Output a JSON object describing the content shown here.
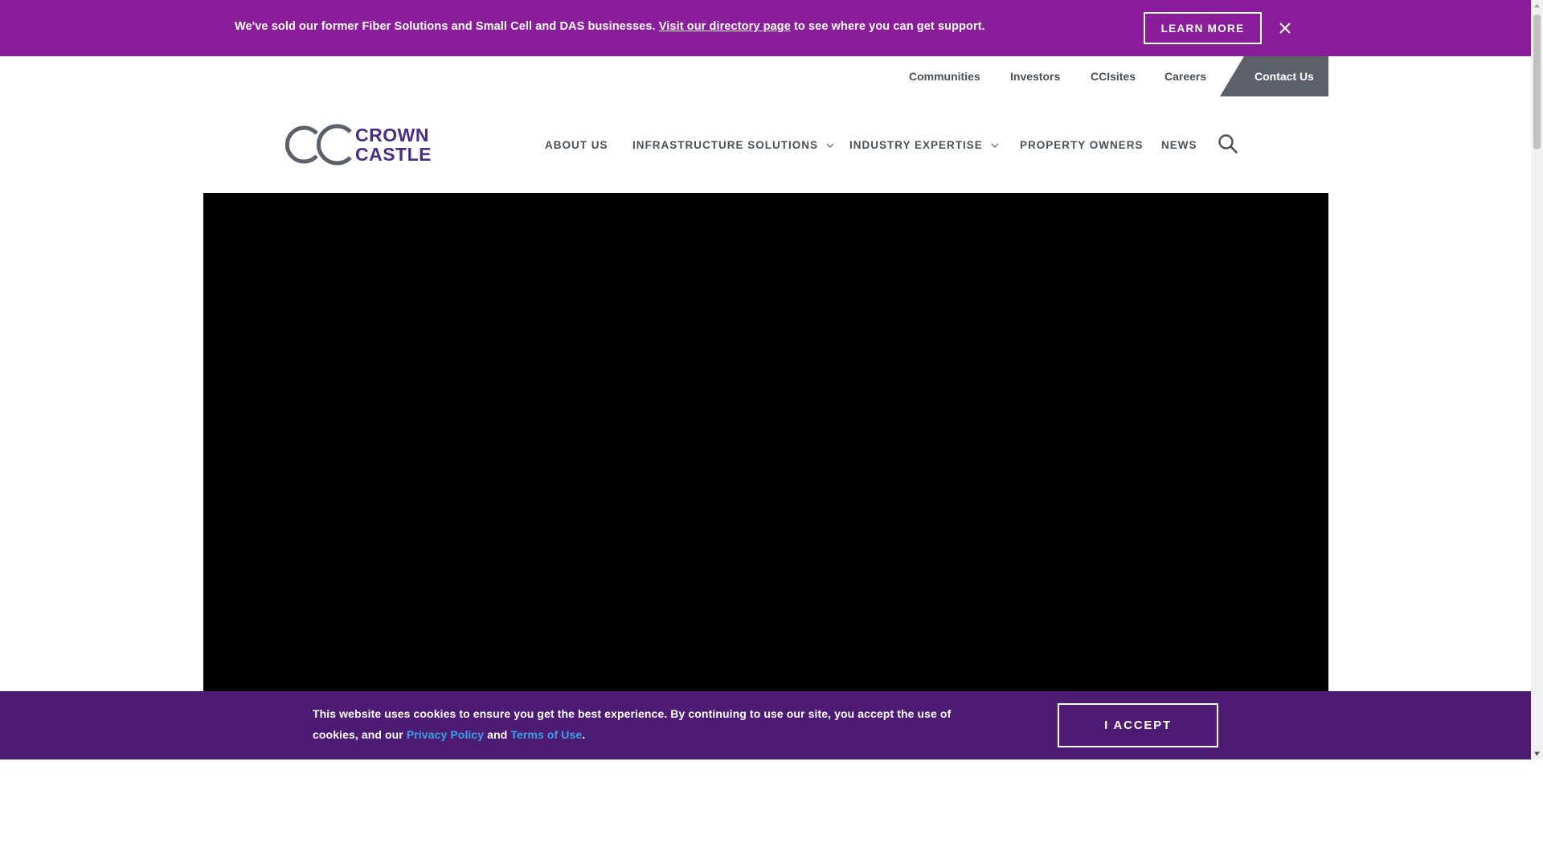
{
  "banner": {
    "text_before": "We've sold our former Fiber Solutions and Small Cell and DAS businesses. ",
    "link_text": "Visit our directory page",
    "text_after": " to see where you can get support.",
    "learn_more": "LEARN MORE"
  },
  "utility_nav": {
    "items": [
      "Communities",
      "Investors",
      "CCIsites",
      "Careers"
    ],
    "contact": "Contact Us"
  },
  "logo": {
    "line1": "CROWN",
    "line2": "CASTLE"
  },
  "main_nav": {
    "items": [
      {
        "label": "ABOUT US"
      },
      {
        "label": "INFRASTRUCTURE SOLUTIONS"
      },
      {
        "label": "INDUSTRY EXPERTISE"
      },
      {
        "label": "PROPERTY OWNERS"
      },
      {
        "label": "NEWS"
      }
    ]
  },
  "cookie": {
    "text_1": "This website uses cookies to ensure you get the best experience. By continuing to use our site, you accept the use of cookies, and our ",
    "privacy": "Privacy Policy",
    "and": " and ",
    "terms": "Terms of Use",
    "end": ".",
    "accept": "I ACCEPT"
  },
  "colors": {
    "banner": "#8a1e9a",
    "brand_purple": "#4b2c87",
    "cookie_bar": "#4d1b73",
    "contact_tab": "#5b6069",
    "link_blue": "#3aa3e8"
  },
  "icons": [
    "close-icon",
    "chevron-down-icon",
    "search-icon"
  ]
}
